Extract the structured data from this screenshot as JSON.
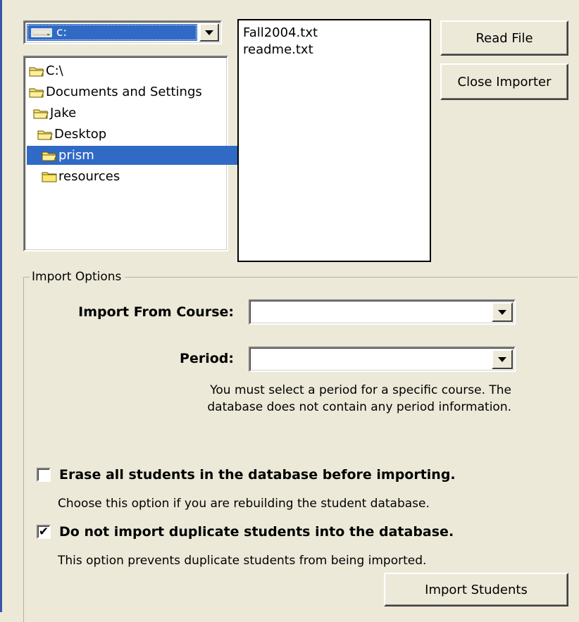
{
  "drive_combo": {
    "value": "c:",
    "icon": "drive-icon"
  },
  "folder_tree": {
    "items": [
      {
        "label": "C:\\",
        "indent": 0,
        "icon": "open-folder-icon",
        "selected": false
      },
      {
        "label": "Documents and Settings",
        "indent": 0,
        "icon": "open-folder-icon",
        "selected": false
      },
      {
        "label": "Jake",
        "indent": 1,
        "icon": "open-folder-icon",
        "selected": false
      },
      {
        "label": "Desktop",
        "indent": 2,
        "icon": "open-folder-icon",
        "selected": false
      },
      {
        "label": "prism",
        "indent": 3,
        "icon": "open-folder-icon",
        "selected": true
      },
      {
        "label": "resources",
        "indent": 3,
        "icon": "closed-folder-icon",
        "selected": false
      }
    ]
  },
  "file_list": {
    "items": [
      "Fall2004.txt",
      "readme.txt"
    ]
  },
  "buttons": {
    "read_file": "Read File",
    "close_importer": "Close Importer",
    "import_students": "Import Students"
  },
  "import_options": {
    "legend": "Import Options",
    "course_label": "Import From Course:",
    "course_value": "",
    "period_label": "Period:",
    "period_value": "",
    "period_note_line1": "You must select a period for a specific course. The",
    "period_note_line2": "database does not contain any period information.",
    "erase": {
      "label": "Erase all students in the database before importing.",
      "description": "Choose this option if you are rebuilding the student database.",
      "checked": false
    },
    "no_duplicates": {
      "label": "Do not import duplicate students into the database.",
      "description": "This option prevents duplicate students from being imported.",
      "checked": true,
      "check_glyph": "✔"
    }
  },
  "colors": {
    "selection": "#316ac5",
    "face": "#ece9d8",
    "accent_strip": "#3a55a8"
  }
}
